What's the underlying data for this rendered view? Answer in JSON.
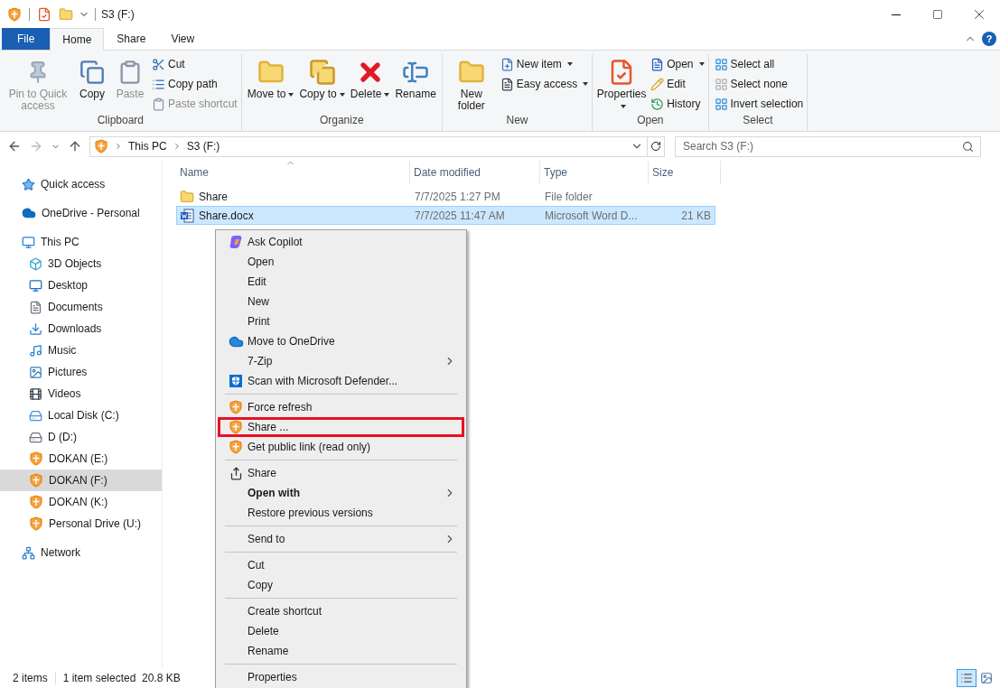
{
  "window": {
    "title": "S3 (F:)"
  },
  "ribbon_tabs": [
    {
      "label": "File",
      "kind": "file",
      "selected": false
    },
    {
      "label": "Home",
      "kind": "tab",
      "selected": true
    },
    {
      "label": "Share",
      "kind": "tab",
      "selected": false
    },
    {
      "label": "View",
      "kind": "tab",
      "selected": false
    }
  ],
  "help": {
    "label": "?"
  },
  "ribbon_groups": [
    {
      "label": "Clipboard",
      "large": [
        {
          "label": "Pin to Quick access",
          "disabled": true,
          "dropdown": false
        },
        {
          "label": "Copy",
          "disabled": false,
          "dropdown": false
        },
        {
          "label": "Paste",
          "disabled": true,
          "dropdown": false
        }
      ],
      "small": [
        {
          "label": "Cut",
          "disabled": false,
          "dropdown": false
        },
        {
          "label": "Copy path",
          "disabled": false,
          "dropdown": false
        },
        {
          "label": "Paste shortcut",
          "disabled": true,
          "dropdown": false
        }
      ]
    },
    {
      "label": "Organize",
      "large": [
        {
          "label": "Move to",
          "disabled": false,
          "dropdown": true
        },
        {
          "label": "Copy to",
          "disabled": false,
          "dropdown": true
        },
        {
          "label": "Delete",
          "disabled": false,
          "dropdown": true
        },
        {
          "label": "Rename",
          "disabled": false,
          "dropdown": false
        }
      ]
    },
    {
      "label": "New",
      "large": [
        {
          "label": "New folder",
          "disabled": false,
          "dropdown": false
        }
      ],
      "small": [
        {
          "label": "New item",
          "disabled": false,
          "dropdown": true
        },
        {
          "label": "Easy access",
          "disabled": false,
          "dropdown": true
        }
      ]
    },
    {
      "label": "Open",
      "large": [
        {
          "label": "Properties",
          "disabled": false,
          "dropdown": true
        }
      ],
      "small": [
        {
          "label": "Open",
          "disabled": false,
          "dropdown": true
        },
        {
          "label": "Edit",
          "disabled": false,
          "dropdown": false
        },
        {
          "label": "History",
          "disabled": false,
          "dropdown": false
        }
      ]
    },
    {
      "label": "Select",
      "small": [
        {
          "label": "Select all",
          "disabled": false,
          "dropdown": false
        },
        {
          "label": "Select none",
          "disabled": false,
          "dropdown": false
        },
        {
          "label": "Invert selection",
          "disabled": false,
          "dropdown": false
        }
      ]
    }
  ],
  "address": {
    "crumbs": [
      "This PC",
      "S3 (F:)"
    ]
  },
  "search": {
    "placeholder": "Search S3 (F:)"
  },
  "sidebar": {
    "items": [
      {
        "label": "Quick access",
        "selected": false
      },
      {
        "label": "OneDrive - Personal",
        "selected": false
      },
      {
        "label": "This PC",
        "selected": false,
        "children": [
          {
            "label": "3D Objects",
            "selected": false
          },
          {
            "label": "Desktop",
            "selected": false
          },
          {
            "label": "Documents",
            "selected": false
          },
          {
            "label": "Downloads",
            "selected": false
          },
          {
            "label": "Music",
            "selected": false
          },
          {
            "label": "Pictures",
            "selected": false
          },
          {
            "label": "Videos",
            "selected": false
          },
          {
            "label": "Local Disk (C:)",
            "selected": false
          },
          {
            "label": "D (D:)",
            "selected": false
          },
          {
            "label": "DOKAN (E:)",
            "selected": false
          },
          {
            "label": "DOKAN (F:)",
            "selected": true
          },
          {
            "label": "DOKAN (K:)",
            "selected": false
          },
          {
            "label": "Personal Drive (U:)",
            "selected": false
          }
        ]
      },
      {
        "label": "Network",
        "selected": false
      }
    ]
  },
  "table": {
    "columns": [
      "Name",
      "Date modified",
      "Type",
      "Size"
    ],
    "rows": [
      {
        "kind": "folder",
        "name": "Share",
        "date": "7/7/2025 1:27 PM",
        "type": "File folder",
        "size": "",
        "selected": false
      },
      {
        "kind": "word",
        "name": "Share.docx",
        "date": "7/7/2025 11:47 AM",
        "type": "Microsoft Word D...",
        "size": "21 KB",
        "selected": true
      }
    ]
  },
  "context_menu": {
    "items": [
      {
        "kind": "item",
        "label": "Ask Copilot",
        "bold": false,
        "submenu": false,
        "highlighted": false
      },
      {
        "kind": "item",
        "label": "Open",
        "bold": false,
        "submenu": false,
        "highlighted": false
      },
      {
        "kind": "item",
        "label": "Edit",
        "bold": false,
        "submenu": false,
        "highlighted": false
      },
      {
        "kind": "item",
        "label": "New",
        "bold": false,
        "submenu": false,
        "highlighted": false
      },
      {
        "kind": "item",
        "label": "Print",
        "bold": false,
        "submenu": false,
        "highlighted": false
      },
      {
        "kind": "item",
        "label": "Move to OneDrive",
        "bold": false,
        "submenu": false,
        "highlighted": false
      },
      {
        "kind": "item",
        "label": "7-Zip",
        "bold": false,
        "submenu": true,
        "highlighted": false
      },
      {
        "kind": "item",
        "label": "Scan with Microsoft Defender...",
        "bold": false,
        "submenu": false,
        "highlighted": false
      },
      {
        "kind": "separator"
      },
      {
        "kind": "item",
        "label": "Force refresh",
        "bold": false,
        "submenu": false,
        "highlighted": false
      },
      {
        "kind": "item",
        "label": "Share ...",
        "bold": false,
        "submenu": false,
        "highlighted": true
      },
      {
        "kind": "item",
        "label": "Get public link (read only)",
        "bold": false,
        "submenu": false,
        "highlighted": false
      },
      {
        "kind": "separator"
      },
      {
        "kind": "item",
        "label": "Share",
        "bold": false,
        "submenu": false,
        "highlighted": false
      },
      {
        "kind": "item",
        "label": "Open with",
        "bold": true,
        "submenu": true,
        "highlighted": false
      },
      {
        "kind": "item",
        "label": "Restore previous versions",
        "bold": false,
        "submenu": false,
        "highlighted": false
      },
      {
        "kind": "separator"
      },
      {
        "kind": "item",
        "label": "Send to",
        "bold": false,
        "submenu": true,
        "highlighted": false
      },
      {
        "kind": "separator"
      },
      {
        "kind": "item",
        "label": "Cut",
        "bold": false,
        "submenu": false,
        "highlighted": false
      },
      {
        "kind": "item",
        "label": "Copy",
        "bold": false,
        "submenu": false,
        "highlighted": false
      },
      {
        "kind": "separator"
      },
      {
        "kind": "item",
        "label": "Create shortcut",
        "bold": false,
        "submenu": false,
        "highlighted": false
      },
      {
        "kind": "item",
        "label": "Delete",
        "bold": false,
        "submenu": false,
        "highlighted": false
      },
      {
        "kind": "item",
        "label": "Rename",
        "bold": false,
        "submenu": false,
        "highlighted": false
      },
      {
        "kind": "separator"
      },
      {
        "kind": "item",
        "label": "Properties",
        "bold": false,
        "submenu": false,
        "highlighted": false
      }
    ]
  },
  "status_bar": {
    "count": "2 items",
    "selection": "1 item selected  20.8 KB",
    "views": [
      {
        "kind": "details",
        "selected": true
      },
      {
        "kind": "large",
        "selected": false
      }
    ]
  }
}
